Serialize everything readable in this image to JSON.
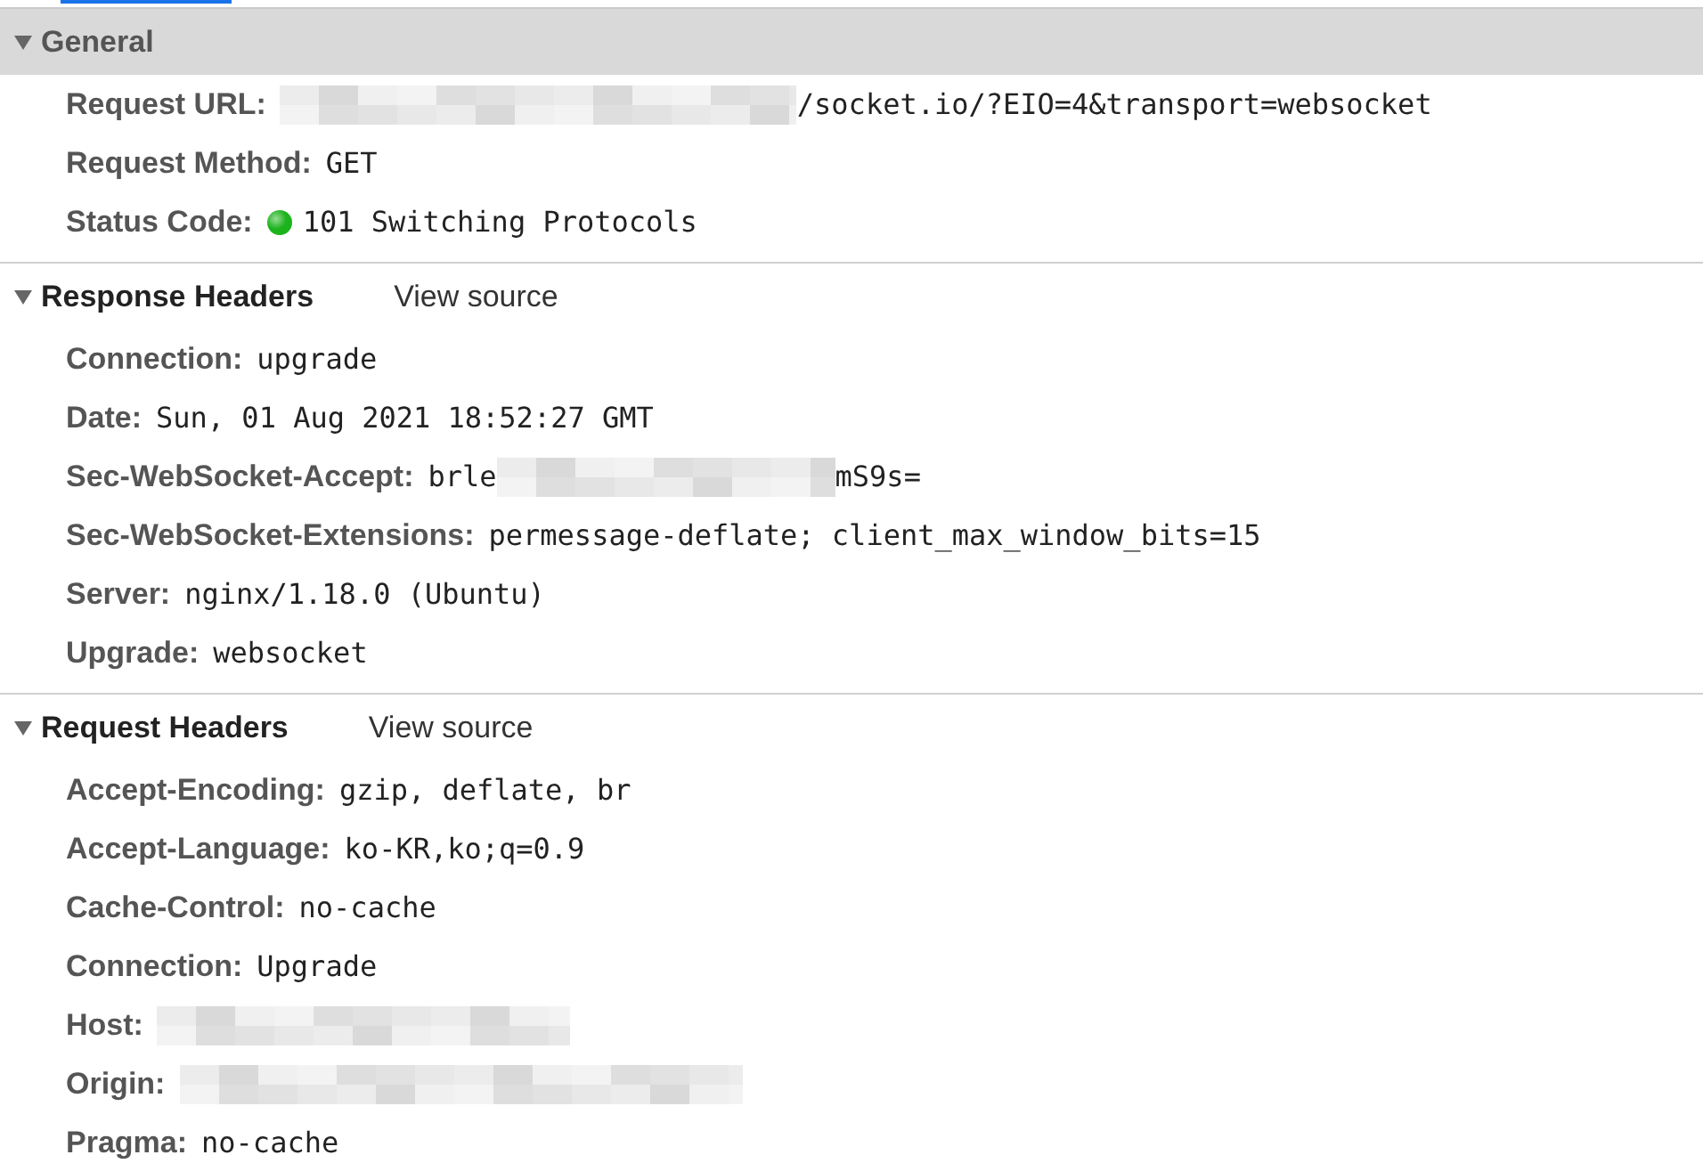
{
  "sections": [
    {
      "title": "General",
      "expanded": true,
      "highlighted": true,
      "rows": [
        {
          "name": "Request URL:",
          "parts": [
            {
              "kind": "redacted"
            },
            {
              "kind": "text",
              "text": "/socket.io/?EIO=4&transport=websocket"
            }
          ]
        },
        {
          "name": "Request Method:",
          "parts": [
            {
              "kind": "text",
              "text": "GET"
            }
          ]
        },
        {
          "name": "Status Code:",
          "parts": [
            {
              "kind": "dot",
              "color": "#1db31d"
            },
            {
              "kind": "text",
              "text": "101 Switching Protocols"
            }
          ]
        }
      ]
    },
    {
      "title": "Response Headers",
      "expanded": true,
      "highlighted": false,
      "link": "View source",
      "rows": [
        {
          "name": "Connection:",
          "parts": [
            {
              "kind": "text",
              "text": "upgrade"
            }
          ]
        },
        {
          "name": "Date:",
          "parts": [
            {
              "kind": "text",
              "text": "Sun, 01 Aug 2021 18:52:27 GMT"
            }
          ]
        },
        {
          "name": "Sec-WebSocket-Accept:",
          "parts": [
            {
              "kind": "text",
              "text": "brle"
            },
            {
              "kind": "redacted"
            },
            {
              "kind": "text",
              "text": "mS9s="
            }
          ]
        },
        {
          "name": "Sec-WebSocket-Extensions:",
          "parts": [
            {
              "kind": "text",
              "text": "permessage-deflate; client_max_window_bits=15"
            }
          ]
        },
        {
          "name": "Server:",
          "parts": [
            {
              "kind": "text",
              "text": "nginx/1.18.0 (Ubuntu)"
            }
          ]
        },
        {
          "name": "Upgrade:",
          "parts": [
            {
              "kind": "text",
              "text": "websocket"
            }
          ]
        }
      ]
    },
    {
      "title": "Request Headers",
      "expanded": true,
      "highlighted": false,
      "link": "View source",
      "rows": [
        {
          "name": "Accept-Encoding:",
          "parts": [
            {
              "kind": "text",
              "text": "gzip, deflate, br"
            }
          ]
        },
        {
          "name": "Accept-Language:",
          "parts": [
            {
              "kind": "text",
              "text": "ko-KR,ko;q=0.9"
            }
          ]
        },
        {
          "name": "Cache-Control:",
          "parts": [
            {
              "kind": "text",
              "text": "no-cache"
            }
          ]
        },
        {
          "name": "Connection:",
          "parts": [
            {
              "kind": "text",
              "text": "Upgrade"
            }
          ]
        },
        {
          "name": "Host:",
          "parts": [
            {
              "kind": "redacted"
            }
          ]
        },
        {
          "name": "Origin:",
          "parts": [
            {
              "kind": "redacted"
            }
          ]
        },
        {
          "name": "Pragma:",
          "parts": [
            {
              "kind": "text",
              "text": "no-cache"
            }
          ]
        }
      ]
    }
  ]
}
